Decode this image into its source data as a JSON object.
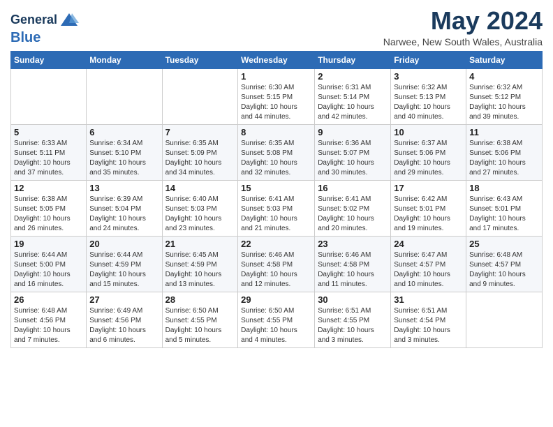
{
  "header": {
    "logo_line1": "General",
    "logo_line2": "Blue",
    "title": "May 2024",
    "subtitle": "Narwee, New South Wales, Australia"
  },
  "calendar": {
    "days_of_week": [
      "Sunday",
      "Monday",
      "Tuesday",
      "Wednesday",
      "Thursday",
      "Friday",
      "Saturday"
    ],
    "weeks": [
      [
        {
          "day": "",
          "info": ""
        },
        {
          "day": "",
          "info": ""
        },
        {
          "day": "",
          "info": ""
        },
        {
          "day": "1",
          "info": "Sunrise: 6:30 AM\nSunset: 5:15 PM\nDaylight: 10 hours\nand 44 minutes."
        },
        {
          "day": "2",
          "info": "Sunrise: 6:31 AM\nSunset: 5:14 PM\nDaylight: 10 hours\nand 42 minutes."
        },
        {
          "day": "3",
          "info": "Sunrise: 6:32 AM\nSunset: 5:13 PM\nDaylight: 10 hours\nand 40 minutes."
        },
        {
          "day": "4",
          "info": "Sunrise: 6:32 AM\nSunset: 5:12 PM\nDaylight: 10 hours\nand 39 minutes."
        }
      ],
      [
        {
          "day": "5",
          "info": "Sunrise: 6:33 AM\nSunset: 5:11 PM\nDaylight: 10 hours\nand 37 minutes."
        },
        {
          "day": "6",
          "info": "Sunrise: 6:34 AM\nSunset: 5:10 PM\nDaylight: 10 hours\nand 35 minutes."
        },
        {
          "day": "7",
          "info": "Sunrise: 6:35 AM\nSunset: 5:09 PM\nDaylight: 10 hours\nand 34 minutes."
        },
        {
          "day": "8",
          "info": "Sunrise: 6:35 AM\nSunset: 5:08 PM\nDaylight: 10 hours\nand 32 minutes."
        },
        {
          "day": "9",
          "info": "Sunrise: 6:36 AM\nSunset: 5:07 PM\nDaylight: 10 hours\nand 30 minutes."
        },
        {
          "day": "10",
          "info": "Sunrise: 6:37 AM\nSunset: 5:06 PM\nDaylight: 10 hours\nand 29 minutes."
        },
        {
          "day": "11",
          "info": "Sunrise: 6:38 AM\nSunset: 5:06 PM\nDaylight: 10 hours\nand 27 minutes."
        }
      ],
      [
        {
          "day": "12",
          "info": "Sunrise: 6:38 AM\nSunset: 5:05 PM\nDaylight: 10 hours\nand 26 minutes."
        },
        {
          "day": "13",
          "info": "Sunrise: 6:39 AM\nSunset: 5:04 PM\nDaylight: 10 hours\nand 24 minutes."
        },
        {
          "day": "14",
          "info": "Sunrise: 6:40 AM\nSunset: 5:03 PM\nDaylight: 10 hours\nand 23 minutes."
        },
        {
          "day": "15",
          "info": "Sunrise: 6:41 AM\nSunset: 5:03 PM\nDaylight: 10 hours\nand 21 minutes."
        },
        {
          "day": "16",
          "info": "Sunrise: 6:41 AM\nSunset: 5:02 PM\nDaylight: 10 hours\nand 20 minutes."
        },
        {
          "day": "17",
          "info": "Sunrise: 6:42 AM\nSunset: 5:01 PM\nDaylight: 10 hours\nand 19 minutes."
        },
        {
          "day": "18",
          "info": "Sunrise: 6:43 AM\nSunset: 5:01 PM\nDaylight: 10 hours\nand 17 minutes."
        }
      ],
      [
        {
          "day": "19",
          "info": "Sunrise: 6:44 AM\nSunset: 5:00 PM\nDaylight: 10 hours\nand 16 minutes."
        },
        {
          "day": "20",
          "info": "Sunrise: 6:44 AM\nSunset: 4:59 PM\nDaylight: 10 hours\nand 15 minutes."
        },
        {
          "day": "21",
          "info": "Sunrise: 6:45 AM\nSunset: 4:59 PM\nDaylight: 10 hours\nand 13 minutes."
        },
        {
          "day": "22",
          "info": "Sunrise: 6:46 AM\nSunset: 4:58 PM\nDaylight: 10 hours\nand 12 minutes."
        },
        {
          "day": "23",
          "info": "Sunrise: 6:46 AM\nSunset: 4:58 PM\nDaylight: 10 hours\nand 11 minutes."
        },
        {
          "day": "24",
          "info": "Sunrise: 6:47 AM\nSunset: 4:57 PM\nDaylight: 10 hours\nand 10 minutes."
        },
        {
          "day": "25",
          "info": "Sunrise: 6:48 AM\nSunset: 4:57 PM\nDaylight: 10 hours\nand 9 minutes."
        }
      ],
      [
        {
          "day": "26",
          "info": "Sunrise: 6:48 AM\nSunset: 4:56 PM\nDaylight: 10 hours\nand 7 minutes."
        },
        {
          "day": "27",
          "info": "Sunrise: 6:49 AM\nSunset: 4:56 PM\nDaylight: 10 hours\nand 6 minutes."
        },
        {
          "day": "28",
          "info": "Sunrise: 6:50 AM\nSunset: 4:55 PM\nDaylight: 10 hours\nand 5 minutes."
        },
        {
          "day": "29",
          "info": "Sunrise: 6:50 AM\nSunset: 4:55 PM\nDaylight: 10 hours\nand 4 minutes."
        },
        {
          "day": "30",
          "info": "Sunrise: 6:51 AM\nSunset: 4:55 PM\nDaylight: 10 hours\nand 3 minutes."
        },
        {
          "day": "31",
          "info": "Sunrise: 6:51 AM\nSunset: 4:54 PM\nDaylight: 10 hours\nand 3 minutes."
        },
        {
          "day": "",
          "info": ""
        }
      ]
    ]
  }
}
